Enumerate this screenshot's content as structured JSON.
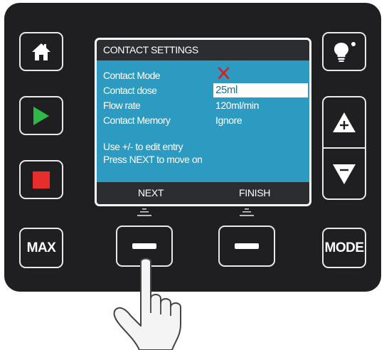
{
  "screen": {
    "title": "CONTACT SETTINGS",
    "rows": [
      {
        "label": "Contact Mode",
        "value": "X"
      },
      {
        "label": "Contact dose",
        "value": "25ml"
      },
      {
        "label": "Flow rate",
        "value": "120ml/min"
      },
      {
        "label": "Contact Memory",
        "value": "Ignore"
      }
    ],
    "hints": [
      "Use +/- to edit entry",
      "Press NEXT to move on"
    ],
    "softkeys": {
      "left": "NEXT",
      "right": "FINISH"
    }
  },
  "buttons": {
    "max": "MAX",
    "mode": "MODE"
  },
  "icons": {
    "home": "home-icon",
    "play": "play-icon",
    "stop": "stop-icon",
    "light": "lightbulb-icon",
    "plus": "plus-triangle-icon",
    "minus": "minus-triangle-icon",
    "status_x": "x-mark-icon"
  },
  "colors": {
    "panel": "#1f1f21",
    "screen": "#2d9bc1",
    "play": "#2fb84a",
    "stop": "#e82d2d",
    "status_x": "#d62020"
  }
}
